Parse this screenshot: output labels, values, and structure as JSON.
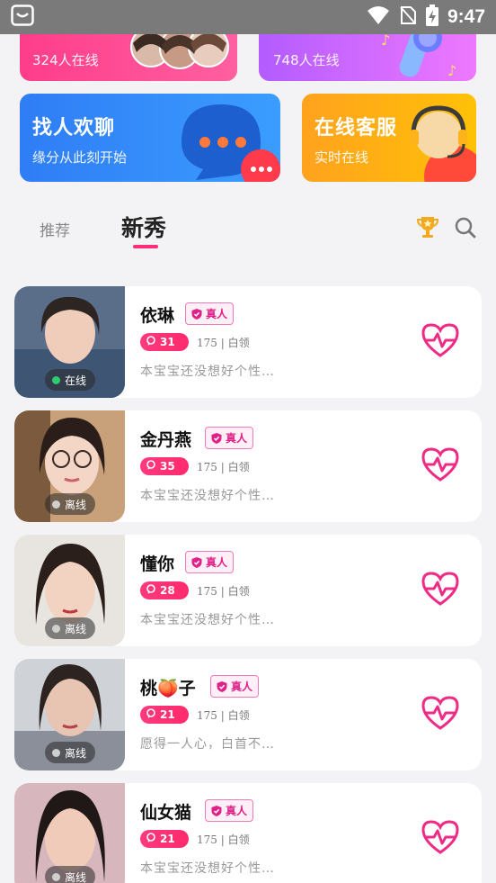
{
  "status_bar": {
    "time": "9:47"
  },
  "cards": {
    "video": {
      "subtitle": "324人在线"
    },
    "voice": {
      "subtitle": "748人在线"
    },
    "chat": {
      "title": "找人欢聊",
      "subtitle": "缘分从此刻开始"
    },
    "service": {
      "title": "在线客服",
      "subtitle": "实时在线"
    }
  },
  "tabs": {
    "recommend": "推荐",
    "new": "新秀"
  },
  "profiles": [
    {
      "name": "依琳",
      "verified": "真人",
      "age": "31",
      "meta": "175 | 白领",
      "bio": "本宝宝还没想好个性…",
      "status": "在线",
      "status_color": "#2ecc71"
    },
    {
      "name": "金丹燕",
      "verified": "真人",
      "age": "35",
      "meta": "175 | 白领",
      "bio": "本宝宝还没想好个性…",
      "status": "离线",
      "status_color": "#cfcfcf"
    },
    {
      "name": "懂你",
      "verified": "真人",
      "age": "28",
      "meta": "175 | 白领",
      "bio": "本宝宝还没想好个性…",
      "status": "离线",
      "status_color": "#cfcfcf"
    },
    {
      "name": "桃🍑子",
      "verified": "真人",
      "age": "21",
      "meta": "175 | 白领",
      "bio": "愿得一人心，白首不…",
      "status": "离线",
      "status_color": "#cfcfcf"
    },
    {
      "name": "仙女猫",
      "verified": "真人",
      "age": "21",
      "meta": "175 | 白领",
      "bio": "本宝宝还没想好个性…",
      "status": "离线",
      "status_color": "#cfcfcf"
    }
  ],
  "colors": {
    "accent": "#ff2d7a",
    "heart": "#ee2c86"
  }
}
